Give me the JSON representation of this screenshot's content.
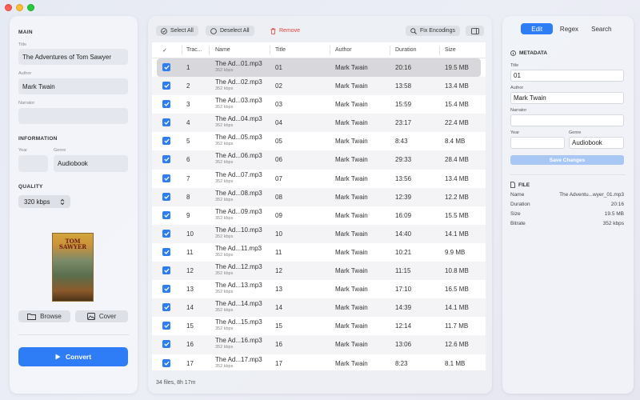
{
  "left": {
    "main_title": "MAIN",
    "title_label": "Title",
    "title_value": "The Adventures of Tom Sawyer",
    "author_label": "Author",
    "author_value": "Mark Twain",
    "narrator_label": "Narrator",
    "narrator_value": "",
    "info_title": "INFORMATION",
    "year_label": "Year",
    "year_value": "",
    "genre_label": "Genre",
    "genre_value": "Audiobook",
    "quality_title": "QUALITY",
    "quality_value": "320 kbps",
    "cover_title": "TOM SAWYER",
    "browse_label": "Browse",
    "cover_label": "Cover",
    "convert_label": "Convert"
  },
  "toolbar": {
    "select_all": "Select All",
    "deselect_all": "Deselect All",
    "remove": "Remove",
    "fix_encodings": "Fix Encodings"
  },
  "table": {
    "headers": {
      "check": "✓",
      "track": "Trac...",
      "name": "Name",
      "title": "Title",
      "author": "Author",
      "duration": "Duration",
      "size": "Size"
    },
    "rows": [
      {
        "track": "1",
        "name": "The Ad...01.mp3",
        "kbps": "352 kbps",
        "title": "01",
        "author": "Mark Twain",
        "duration": "20:16",
        "size": "19.5 MB"
      },
      {
        "track": "2",
        "name": "The Ad...02.mp3",
        "kbps": "352 kbps",
        "title": "02",
        "author": "Mark Twain",
        "duration": "13:58",
        "size": "13.4 MB"
      },
      {
        "track": "3",
        "name": "The Ad...03.mp3",
        "kbps": "352 kbps",
        "title": "03",
        "author": "Mark Twain",
        "duration": "15:59",
        "size": "15.4 MB"
      },
      {
        "track": "4",
        "name": "The Ad...04.mp3",
        "kbps": "352 kbps",
        "title": "04",
        "author": "Mark Twain",
        "duration": "23:17",
        "size": "22.4 MB"
      },
      {
        "track": "5",
        "name": "The Ad...05.mp3",
        "kbps": "352 kbps",
        "title": "05",
        "author": "Mark Twain",
        "duration": "8:43",
        "size": "8.4 MB"
      },
      {
        "track": "6",
        "name": "The Ad...06.mp3",
        "kbps": "352 kbps",
        "title": "06",
        "author": "Mark Twain",
        "duration": "29:33",
        "size": "28.4 MB"
      },
      {
        "track": "7",
        "name": "The Ad...07.mp3",
        "kbps": "352 kbps",
        "title": "07",
        "author": "Mark Twain",
        "duration": "13:56",
        "size": "13.4 MB"
      },
      {
        "track": "8",
        "name": "The Ad...08.mp3",
        "kbps": "352 kbps",
        "title": "08",
        "author": "Mark Twain",
        "duration": "12:39",
        "size": "12.2 MB"
      },
      {
        "track": "9",
        "name": "The Ad...09.mp3",
        "kbps": "352 kbps",
        "title": "09",
        "author": "Mark Twain",
        "duration": "16:09",
        "size": "15.5 MB"
      },
      {
        "track": "10",
        "name": "The Ad...10.mp3",
        "kbps": "352 kbps",
        "title": "10",
        "author": "Mark Twain",
        "duration": "14:40",
        "size": "14.1 MB"
      },
      {
        "track": "11",
        "name": "The Ad...11.mp3",
        "kbps": "352 kbps",
        "title": "11",
        "author": "Mark Twain",
        "duration": "10:21",
        "size": "9.9 MB"
      },
      {
        "track": "12",
        "name": "The Ad...12.mp3",
        "kbps": "352 kbps",
        "title": "12",
        "author": "Mark Twain",
        "duration": "11:15",
        "size": "10.8 MB"
      },
      {
        "track": "13",
        "name": "The Ad...13.mp3",
        "kbps": "352 kbps",
        "title": "13",
        "author": "Mark Twain",
        "duration": "17:10",
        "size": "16.5 MB"
      },
      {
        "track": "14",
        "name": "The Ad...14.mp3",
        "kbps": "352 kbps",
        "title": "14",
        "author": "Mark Twain",
        "duration": "14:39",
        "size": "14.1 MB"
      },
      {
        "track": "15",
        "name": "The Ad...15.mp3",
        "kbps": "352 kbps",
        "title": "15",
        "author": "Mark Twain",
        "duration": "12:14",
        "size": "11.7 MB"
      },
      {
        "track": "16",
        "name": "The Ad...16.mp3",
        "kbps": "352 kbps",
        "title": "16",
        "author": "Mark Twain",
        "duration": "13:06",
        "size": "12.6 MB"
      },
      {
        "track": "17",
        "name": "The Ad...17.mp3",
        "kbps": "352 kbps",
        "title": "17",
        "author": "Mark Twain",
        "duration": "8:23",
        "size": "8.1 MB"
      }
    ],
    "footer": "34 files, 8h 17m"
  },
  "right": {
    "tabs": [
      "Edit",
      "Regex",
      "Search"
    ],
    "metadata_title": "METADATA",
    "title_label": "Title",
    "title_value": "01",
    "author_label": "Author",
    "author_value": "Mark Twain",
    "narrator_label": "Narrator",
    "narrator_value": "",
    "year_label": "Year",
    "year_value": "",
    "genre_label": "Genre",
    "genre_value": "Audiobook",
    "save_label": "Save Changes",
    "file_title": "FILE",
    "file": [
      {
        "k": "Name",
        "v": "The Adventu...wyer_01.mp3"
      },
      {
        "k": "Duration",
        "v": "20:16"
      },
      {
        "k": "Size",
        "v": "19.5 MB"
      },
      {
        "k": "Bitrate",
        "v": "352 kbps"
      }
    ]
  },
  "colors": {
    "accent": "#2e7cf6",
    "remove": "#e0443e",
    "save_disabled": "#a9c7f5"
  }
}
